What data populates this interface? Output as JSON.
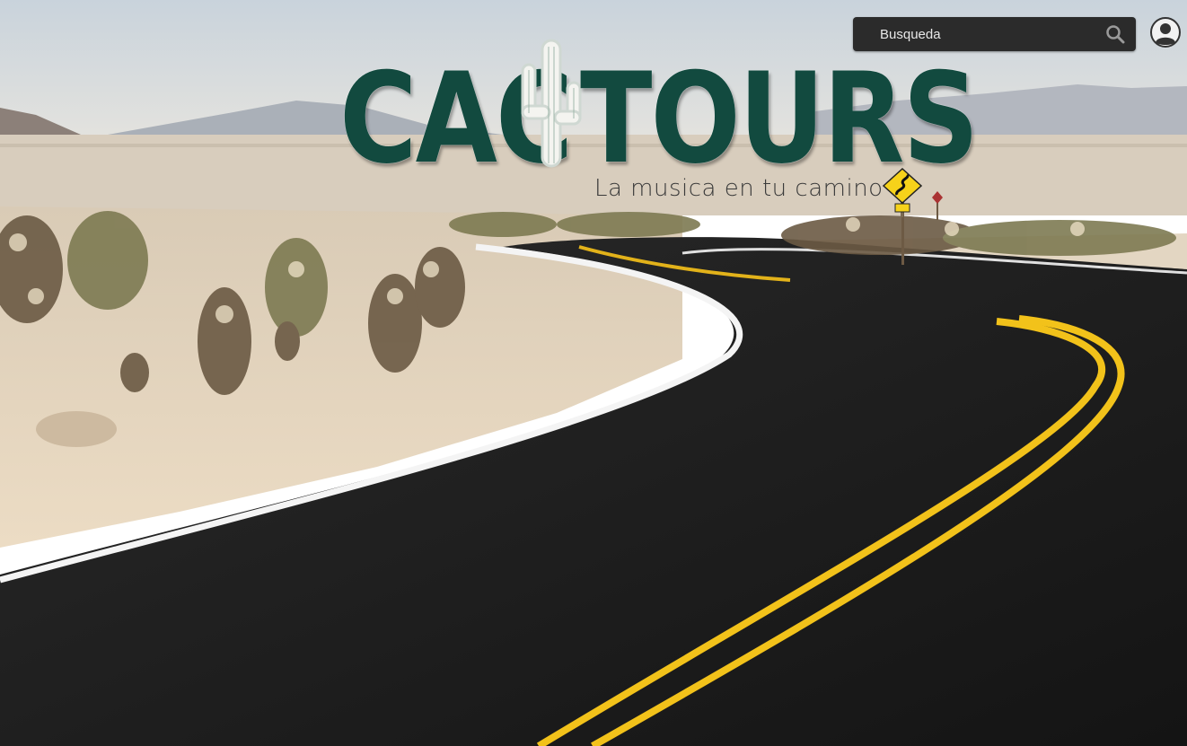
{
  "header": {
    "search": {
      "placeholder": "Busqueda",
      "icon": "search-icon"
    },
    "user_icon": "user-account-icon"
  },
  "brand": {
    "name_left": "CAC",
    "name_right": "TOURS",
    "logo_icon": "cactus-icon",
    "tagline": "La musica en tu camino",
    "tagline_icon": "winding-road-sign-icon",
    "color": "#124a3f"
  },
  "colors": {
    "search_bg": "#2b2b2b",
    "road": "#1e1e1e",
    "center_line": "#f2c21a",
    "edge_line": "#ffffff"
  }
}
